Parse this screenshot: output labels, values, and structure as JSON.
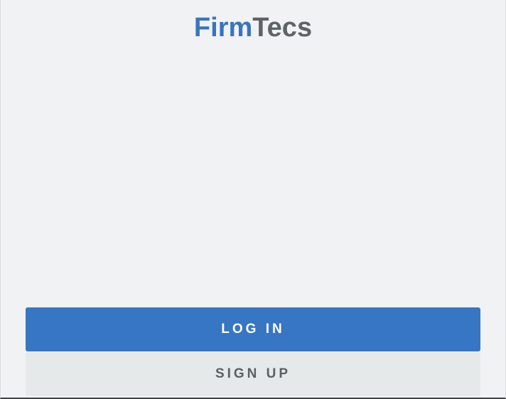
{
  "brand": {
    "part1": "Firm",
    "part2": "Tecs",
    "part1_color": "#3a74bd",
    "part2_color": "#5e6367"
  },
  "actions": {
    "login_label": "LOG IN",
    "signup_label": "SIGN UP",
    "login_color": "#3676c2",
    "signup_color": "#e6e9ea"
  }
}
